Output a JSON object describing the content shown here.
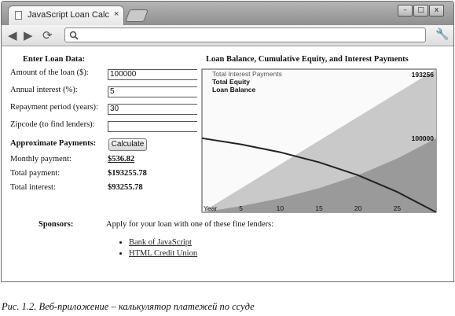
{
  "browser": {
    "tab_title": "JavaScript Loan Calc...",
    "tab_close": "×",
    "window_controls": [
      "–",
      "□",
      "x"
    ],
    "nav": {
      "back": "◀",
      "forward": "▶",
      "reload": "⟳"
    },
    "address": "",
    "menu_icon": "wrench-icon"
  },
  "form": {
    "header": "Enter Loan Data:",
    "amount_label": "Amount of the loan ($):",
    "amount_value": "100000",
    "interest_label": "Annual interest (%):",
    "interest_value": "5",
    "period_label": "Repayment period (years):",
    "period_value": "30",
    "zipcode_label": "Zipcode (to find lenders):",
    "zipcode_value": "",
    "payments_header": "Approximate Payments:",
    "calculate_label": "Calculate",
    "monthly_label": "Monthly payment:",
    "monthly_value": "$536.82",
    "total_label": "Total payment:",
    "total_value": "$193255.78",
    "interest_total_label": "Total interest:",
    "interest_total_value": "$93255.78"
  },
  "sponsors": {
    "label": "Sponsors:",
    "intro": "Apply for your loan with one of these fine lenders:",
    "lenders": [
      "Bank of JavaScript",
      "HTML Credit Union"
    ]
  },
  "chart_data": {
    "type": "area",
    "title": "Loan Balance, Cumulative Equity, and Interest Payments",
    "legend": [
      "Total Interest Payments",
      "Total Equity",
      "Loan Balance"
    ],
    "legend_position": "top-left",
    "x_ticks": [
      "Year",
      "5",
      "10",
      "15",
      "20",
      "25"
    ],
    "x_range": [
      0,
      30
    ],
    "y_range": [
      0,
      193256
    ],
    "y_tick_labels": [
      "193256",
      "100000"
    ],
    "series": [
      {
        "name": "Total Interest Payments",
        "x": [
          0,
          30
        ],
        "y": [
          0,
          193256
        ]
      },
      {
        "name": "Total Equity",
        "x": [
          0,
          5,
          10,
          15,
          20,
          25,
          30
        ],
        "y": [
          0,
          8258,
          18868,
          32512,
          50022,
          72484,
          100000
        ]
      },
      {
        "name": "Loan Balance",
        "x": [
          0,
          5,
          10,
          15,
          20,
          25,
          30
        ],
        "y": [
          100000,
          91742,
          81132,
          67488,
          49978,
          27516,
          0
        ]
      }
    ],
    "colors": {
      "interest": "#c9c9c9",
      "equity": "#9a9a9a",
      "balance": "#222222"
    }
  },
  "caption": "Рис. 1.2. Веб-приложение – калькулятор платежей по ссуде"
}
